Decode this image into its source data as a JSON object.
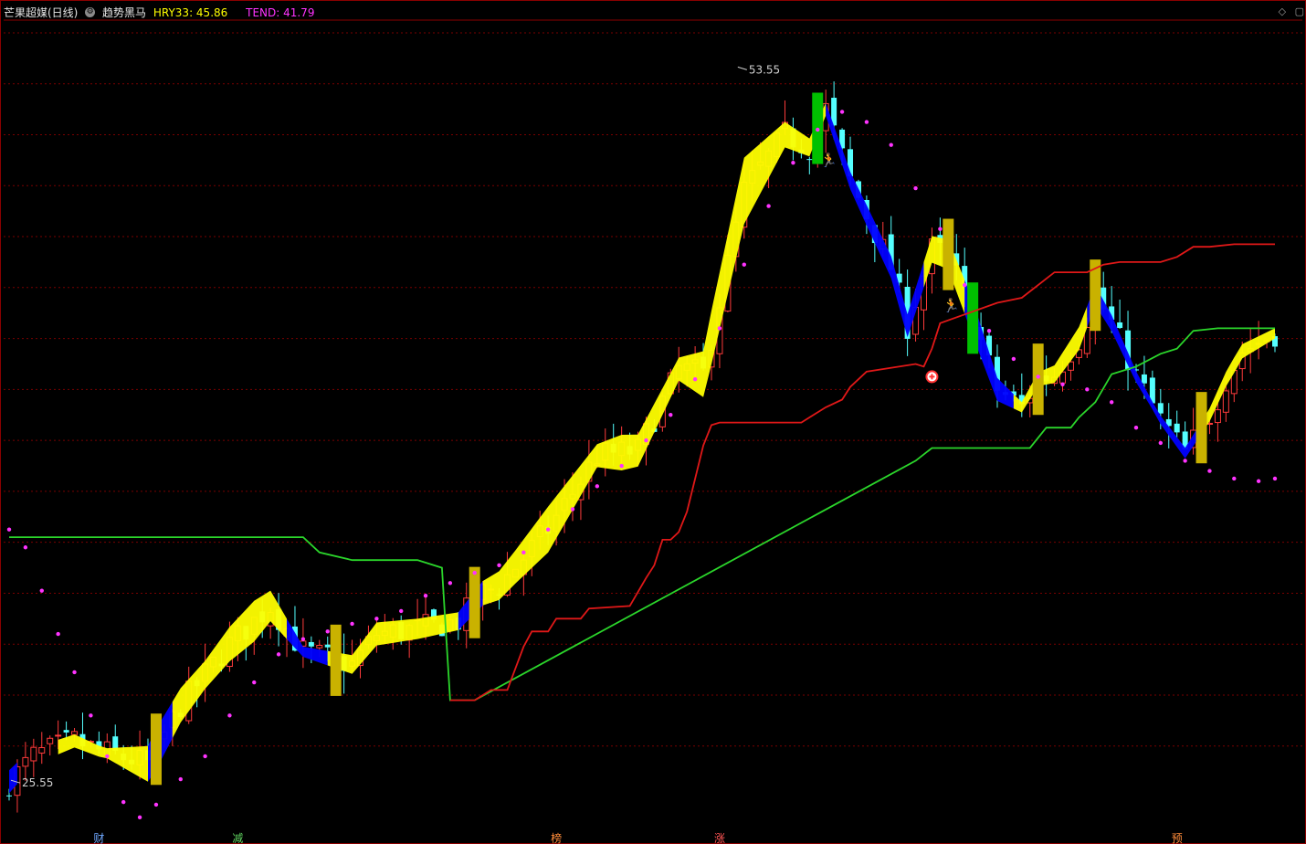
{
  "header": {
    "stock_name": "芒果超媒(日线)",
    "indicator_name": "趋势黑马",
    "hry_label": "HRY33: 45.86",
    "tend_label": "TEND: 41.79",
    "colors": {
      "name": "#e6e6e6",
      "hry": "#ffff00",
      "tend": "#ff33ff"
    }
  },
  "window_controls": {
    "collapse_icon": "◇",
    "maximize_icon": "▢"
  },
  "chart_data": {
    "type": "candlestick",
    "title": "芒果超媒(日线)",
    "ylim": [
      23.8,
      55.5
    ],
    "grid": true,
    "gridlines": [
      27,
      29,
      31,
      33,
      35,
      37,
      39,
      41,
      43,
      45,
      47,
      49,
      51,
      53,
      55
    ],
    "annotations": {
      "high": "53.55",
      "low": "25.55"
    },
    "bottom_markers": [
      {
        "label": "财",
        "bar": 11,
        "color": "#6fa8ff"
      },
      {
        "label": "减",
        "bar": 28,
        "color": "#5fd35f"
      },
      {
        "label": "榜",
        "bar": 67,
        "color": "#ff8c3a"
      },
      {
        "label": "涨",
        "bar": 87,
        "color": "#ff5555"
      },
      {
        "label": "预",
        "bar": 143,
        "color": "#ff8c3a"
      }
    ],
    "icons": [
      {
        "name": "runner-icon",
        "bar": 100,
        "value": 50.0,
        "color": "#ff9a3a"
      },
      {
        "name": "runner-icon",
        "bar": 115,
        "value": 44.3,
        "color": "#ff9a3a"
      },
      {
        "name": "plus-circle-icon",
        "bar": 113,
        "value": 41.5,
        "color": "#ff3333"
      }
    ],
    "colors": {
      "up": "#ff3b3b",
      "down": "#54ffff",
      "band_up": "#ffff00",
      "band_down": "#0000ff",
      "green_line": "#2bd62b",
      "red_line": "#e01818",
      "dots": "#ff33ff",
      "grid": "#7a0000"
    },
    "anchors": {
      "price": [
        [
          0,
          25.6
        ],
        [
          3,
          26.6
        ],
        [
          8,
          27.2
        ],
        [
          11,
          26.8
        ],
        [
          17,
          26.3
        ],
        [
          21,
          28.6
        ],
        [
          27,
          31.0
        ],
        [
          32,
          32.5
        ],
        [
          36,
          30.7
        ],
        [
          42,
          30.2
        ],
        [
          45,
          31.4
        ],
        [
          50,
          31.6
        ],
        [
          55,
          31.9
        ],
        [
          58,
          33.0
        ],
        [
          60,
          33.3
        ],
        [
          66,
          35.5
        ],
        [
          72,
          38.4
        ],
        [
          77,
          38.6
        ],
        [
          82,
          41.8
        ],
        [
          85,
          41.6
        ],
        [
          90,
          48.8
        ],
        [
          95,
          51.0
        ],
        [
          98,
          50.5
        ],
        [
          100,
          52.0
        ],
        [
          103,
          49.2
        ],
        [
          108,
          45.8
        ],
        [
          110,
          43.5
        ],
        [
          113,
          46.5
        ],
        [
          115,
          46.3
        ],
        [
          118,
          43.8
        ],
        [
          121,
          41.0
        ],
        [
          124,
          40.3
        ],
        [
          126,
          41.4
        ],
        [
          128,
          41.6
        ],
        [
          131,
          43.0
        ],
        [
          133,
          44.7
        ],
        [
          135,
          43.6
        ],
        [
          138,
          41.5
        ],
        [
          141,
          39.8
        ],
        [
          144,
          38.5
        ],
        [
          147,
          40.0
        ],
        [
          149,
          41.4
        ],
        [
          151,
          42.5
        ],
        [
          155,
          43.2
        ]
      ],
      "band_width": [
        [
          0,
          0.9
        ],
        [
          5,
          0.6
        ],
        [
          12,
          0.4
        ],
        [
          18,
          1.6
        ],
        [
          24,
          1.1
        ],
        [
          30,
          1.6
        ],
        [
          36,
          0.4
        ],
        [
          45,
          0.9
        ],
        [
          55,
          0.7
        ],
        [
          62,
          1.3
        ],
        [
          66,
          1.8
        ],
        [
          72,
          0.9
        ],
        [
          75,
          1.4
        ],
        [
          82,
          0.9
        ],
        [
          86,
          2.1
        ],
        [
          90,
          2.6
        ],
        [
          95,
          1.0
        ],
        [
          100,
          0.5
        ],
        [
          105,
          0.8
        ],
        [
          110,
          0.9
        ],
        [
          114,
          1.1
        ],
        [
          118,
          1.4
        ],
        [
          124,
          0.4
        ],
        [
          131,
          0.9
        ],
        [
          140,
          0.3
        ],
        [
          150,
          0.6
        ],
        [
          155,
          0.4
        ]
      ],
      "band_trend": [
        [
          0,
          0,
          "down"
        ],
        [
          6,
          16,
          "up"
        ],
        [
          17,
          19,
          "down"
        ],
        [
          20,
          33,
          "up"
        ],
        [
          34,
          38,
          "down"
        ],
        [
          39,
          54,
          "up"
        ],
        [
          55,
          57,
          "down"
        ],
        [
          58,
          99,
          "up"
        ],
        [
          100,
          111,
          "down"
        ],
        [
          112,
          116,
          "up"
        ],
        [
          117,
          122,
          "down"
        ],
        [
          123,
          131,
          "up"
        ],
        [
          132,
          145,
          "down"
        ],
        [
          146,
          155,
          "up"
        ]
      ],
      "dots": [
        [
          0,
          35.5
        ],
        [
          2,
          34.8
        ],
        [
          4,
          33.1
        ],
        [
          6,
          31.4
        ],
        [
          8,
          29.9
        ],
        [
          10,
          28.2
        ],
        [
          12,
          26.6
        ],
        [
          14,
          24.8
        ],
        [
          16,
          24.2
        ],
        [
          18,
          24.7
        ],
        [
          21,
          25.7
        ],
        [
          24,
          26.6
        ],
        [
          27,
          28.2
        ],
        [
          30,
          29.5
        ],
        [
          33,
          30.6
        ],
        [
          36,
          31.2
        ],
        [
          39,
          31.5
        ],
        [
          42,
          31.8
        ],
        [
          45,
          32.0
        ],
        [
          48,
          32.3
        ],
        [
          51,
          32.9
        ],
        [
          54,
          33.4
        ],
        [
          57,
          33.8
        ],
        [
          60,
          34.1
        ],
        [
          63,
          34.6
        ],
        [
          66,
          35.5
        ],
        [
          69,
          36.3
        ],
        [
          72,
          37.2
        ],
        [
          75,
          38.0
        ],
        [
          78,
          39.0
        ],
        [
          81,
          40.0
        ],
        [
          84,
          41.4
        ],
        [
          87,
          43.4
        ],
        [
          90,
          45.9
        ],
        [
          93,
          48.2
        ],
        [
          96,
          49.9
        ],
        [
          99,
          51.2
        ],
        [
          102,
          51.9
        ],
        [
          105,
          51.5
        ],
        [
          108,
          50.6
        ],
        [
          111,
          48.9
        ],
        [
          114,
          47.3
        ],
        [
          117,
          45.1
        ],
        [
          120,
          43.3
        ],
        [
          123,
          42.2
        ],
        [
          126,
          41.5
        ],
        [
          129,
          41.2
        ],
        [
          132,
          41.0
        ],
        [
          135,
          40.5
        ],
        [
          138,
          39.5
        ],
        [
          141,
          38.9
        ],
        [
          144,
          38.2
        ],
        [
          147,
          37.8
        ],
        [
          150,
          37.5
        ],
        [
          153,
          37.4
        ],
        [
          155,
          37.5
        ]
      ],
      "green_line": [
        [
          0,
          35.2
        ],
        [
          36,
          35.2
        ],
        [
          38,
          34.6
        ],
        [
          42,
          34.3
        ],
        [
          50,
          34.3
        ],
        [
          53,
          34.0
        ],
        [
          54,
          28.8
        ],
        [
          57,
          28.8
        ],
        [
          111,
          38.2
        ],
        [
          113,
          38.7
        ],
        [
          125,
          38.7
        ],
        [
          127,
          39.5
        ],
        [
          130,
          39.5
        ],
        [
          131,
          39.9
        ],
        [
          133,
          40.5
        ],
        [
          135,
          41.6
        ],
        [
          138,
          41.9
        ],
        [
          141,
          42.4
        ],
        [
          143,
          42.6
        ],
        [
          145,
          43.3
        ],
        [
          148,
          43.4
        ],
        [
          152,
          43.4
        ],
        [
          155,
          43.4
        ]
      ],
      "red_line": [
        [
          54,
          28.8
        ],
        [
          57,
          28.8
        ],
        [
          59,
          29.2
        ],
        [
          61,
          29.2
        ],
        [
          63,
          30.9
        ],
        [
          64,
          31.5
        ],
        [
          66,
          31.5
        ],
        [
          67,
          32.0
        ],
        [
          70,
          32.0
        ],
        [
          71,
          32.4
        ],
        [
          76,
          32.5
        ],
        [
          78,
          33.6
        ],
        [
          79,
          34.1
        ],
        [
          80,
          35.1
        ],
        [
          81,
          35.1
        ],
        [
          82,
          35.4
        ],
        [
          83,
          36.2
        ],
        [
          85,
          38.8
        ],
        [
          86,
          39.6
        ],
        [
          87,
          39.7
        ],
        [
          95,
          39.7
        ],
        [
          97,
          39.7
        ],
        [
          98,
          39.9
        ],
        [
          100,
          40.3
        ],
        [
          102,
          40.6
        ],
        [
          103,
          41.1
        ],
        [
          104,
          41.4
        ],
        [
          105,
          41.7
        ],
        [
          111,
          42.0
        ],
        [
          112,
          41.9
        ],
        [
          113,
          42.6
        ],
        [
          114,
          43.6
        ],
        [
          121,
          44.4
        ],
        [
          124,
          44.6
        ],
        [
          128,
          45.6
        ],
        [
          132,
          45.6
        ],
        [
          134,
          45.9
        ],
        [
          136,
          46.0
        ],
        [
          141,
          46.0
        ],
        [
          143,
          46.2
        ],
        [
          145,
          46.6
        ],
        [
          147,
          46.6
        ],
        [
          150,
          46.7
        ],
        [
          155,
          46.7
        ]
      ]
    }
  }
}
